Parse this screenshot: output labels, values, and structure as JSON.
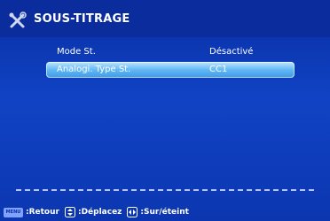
{
  "header": {
    "icon": "tools-icon",
    "title": "SOUS-TITRAGE"
  },
  "menu": {
    "items": [
      {
        "label": "Mode St.",
        "value": "Désactivé",
        "selected": false
      },
      {
        "label": "Analogi. Type St.",
        "value": "CC1",
        "selected": true
      }
    ]
  },
  "footer": {
    "menu_key": "MENU",
    "back_label": ":Retour",
    "move_label": ":Déplacez",
    "toggle_label": ":Sur/éteint"
  },
  "colors": {
    "background": "#0b2f9e",
    "highlight": "#62b8f5",
    "text": "#ffffff"
  }
}
